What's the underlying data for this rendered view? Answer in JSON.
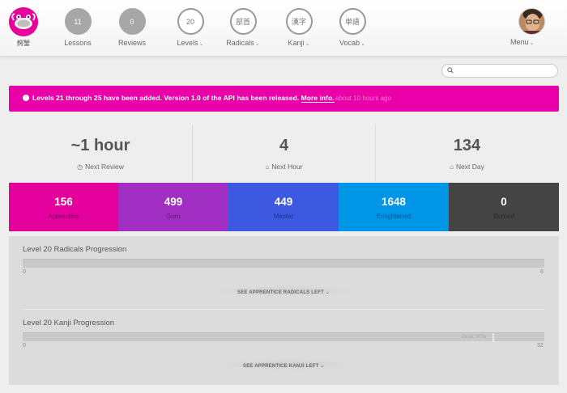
{
  "header": {
    "logo_label": "鰐蟹",
    "nav": [
      {
        "count": "11",
        "label": "Lessons",
        "style": "filled"
      },
      {
        "count": "0",
        "label": "Reviews",
        "style": "filled"
      },
      {
        "count": "20",
        "label": "Levels",
        "style": "outline",
        "dropdown": true
      },
      {
        "count": "部首",
        "label": "Radicals",
        "style": "outline",
        "dropdown": true
      },
      {
        "count": "漢字",
        "label": "Kanji",
        "style": "outline",
        "dropdown": true
      },
      {
        "count": "単語",
        "label": "Vocab",
        "style": "outline",
        "dropdown": true
      }
    ],
    "menu_label": "Menu",
    "caret": "⌄"
  },
  "search": {
    "placeholder": ""
  },
  "alert": {
    "text": "Levels 21 through 25 have been added. Version 1.0 of the API has been released. ",
    "link": "More info.",
    "time": "about 10 hours ago",
    "color": "#e900a9"
  },
  "stats": [
    {
      "value": "~1 hour",
      "label": "Next Review",
      "icon": "clock-icon"
    },
    {
      "value": "4",
      "label": "Next Hour",
      "icon": "inbox-icon"
    },
    {
      "value": "134",
      "label": "Next Day",
      "icon": "inbox-icon"
    }
  ],
  "srs": [
    {
      "count": "156",
      "label": "Apprentice",
      "color": "#e3009c"
    },
    {
      "count": "499",
      "label": "Guru",
      "color": "#a12fc4"
    },
    {
      "count": "449",
      "label": "Master",
      "color": "#3d59df"
    },
    {
      "count": "1648",
      "label": "Enlightened",
      "color": "#0096e8"
    },
    {
      "count": "0",
      "label": "Burned",
      "color": "#444444"
    }
  ],
  "progress": {
    "radicals": {
      "title": "Level 20 Radicals Progression",
      "min": "0",
      "max": "6",
      "link": "SEE APPRENTICE RADICALS LEFT"
    },
    "kanji": {
      "title": "Level 20 Kanji Progression",
      "min": "0",
      "max": "32",
      "goal_label": "Goal: 90%",
      "goal_fraction": 0.9,
      "link": "SEE APPRENTICE KANJI LEFT"
    }
  }
}
